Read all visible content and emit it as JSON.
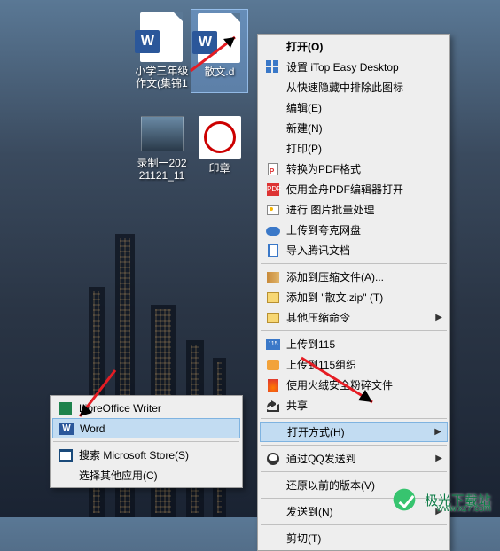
{
  "desktop": {
    "icons": [
      {
        "label": "小学三年级作文(集锦1"
      },
      {
        "label": "散文.d"
      },
      {
        "label": "录制一20221121_11"
      },
      {
        "label": "印章"
      }
    ]
  },
  "context_menu": {
    "open": "打开(O)",
    "itop": "设置 iTop Easy Desktop",
    "exclude": "从快速隐藏中排除此图标",
    "edit": "编辑(E)",
    "new": "新建(N)",
    "print": "打印(P)",
    "to_pdf": "转换为PDF格式",
    "jinzhou_pdf": "使用金舟PDF编辑器打开",
    "batch_img": "进行 图片批量处理",
    "kuake": "上传到夸克网盘",
    "tencent_docs": "导入腾讯文档",
    "add_zip": "添加到压缩文件(A)...",
    "add_named_zip": "添加到 \"散文.zip\" (T)",
    "other_zip": "其他压缩命令",
    "upload_115": "上传到115",
    "upload_115_org": "上传到115组织",
    "huorong": "使用火绒安全粉碎文件",
    "share": "共享",
    "open_with": "打开方式(H)",
    "qq_send": "通过QQ发送到",
    "restore": "还原以前的版本(V)",
    "send_to": "发送到(N)",
    "cut": "剪切(T)"
  },
  "submenu": {
    "libreoffice": "LibreOffice Writer",
    "word": "Word",
    "search_store": "搜索 Microsoft Store(S)",
    "choose_other": "选择其他应用(C)"
  },
  "icon_labels": {
    "115": "115",
    "word_w": "W",
    "pdf2": "PDF"
  },
  "watermark": {
    "text": "极光下载站",
    "url": "www.xz7.com"
  }
}
